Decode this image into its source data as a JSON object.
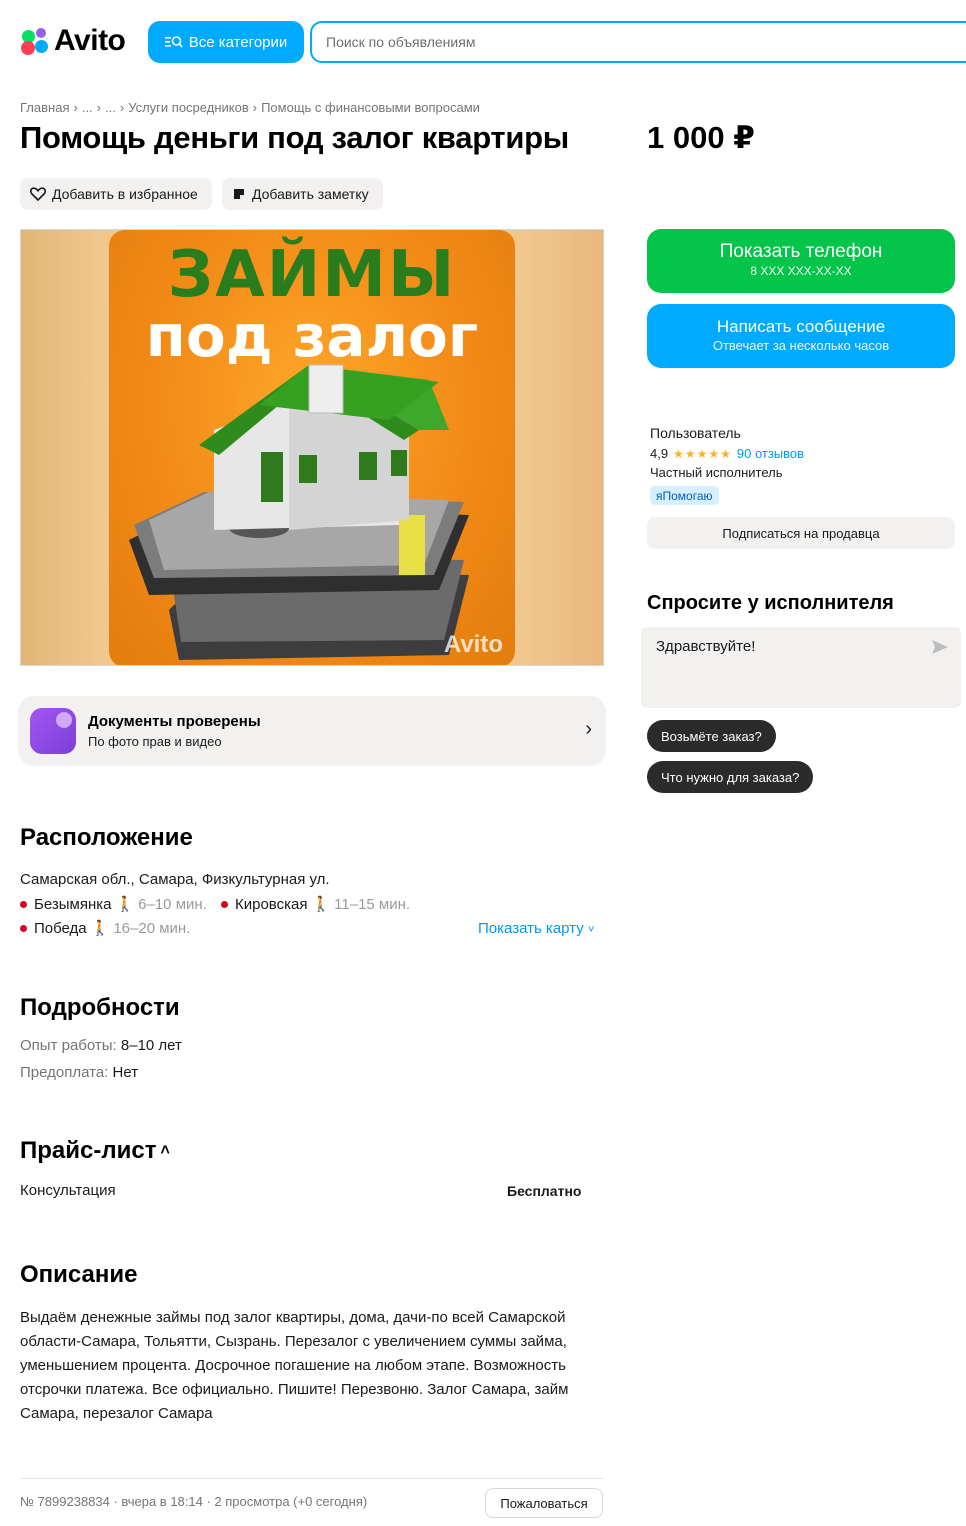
{
  "header": {
    "logo_text": "Avito",
    "categories_button": "Все категории",
    "search_placeholder": "Поиск по объявлениям"
  },
  "breadcrumb": [
    "Главная",
    "›",
    "...",
    "›",
    "...",
    "›",
    "Услуги посредников",
    "›",
    "Помощь с финансовыми вопросами"
  ],
  "listing": {
    "title": "Помощь деньги под залог квартиры",
    "price": "1 000 ₽",
    "favorite_label": "Добавить в избранное",
    "note_label": "Добавить заметку",
    "photo": {
      "line1": "ЗАЙМЫ",
      "line2": "под залог",
      "watermark": "Avito"
    }
  },
  "documents": {
    "title": "Документы проверены",
    "subtitle": "По фото прав и видео"
  },
  "location": {
    "heading": "Расположение",
    "address": "Самарская обл., Самара, Физкультурная ул.",
    "stations": [
      {
        "name": "Безымянка",
        "time": "6–10 мин."
      },
      {
        "name": "Кировская",
        "time": "11–15 мин."
      },
      {
        "name": "Победа",
        "time": "16–20 мин."
      }
    ],
    "show_map": "Показать карту"
  },
  "details": {
    "heading": "Подробности",
    "params": [
      {
        "key": "Опыт работы:",
        "value": "8–10 лет"
      },
      {
        "key": "Предоплата:",
        "value": "Нет"
      }
    ]
  },
  "pricelist": {
    "heading": "Прайс-лист",
    "items": [
      {
        "name": "Консультация",
        "price": "Бесплатно"
      }
    ]
  },
  "description": {
    "heading": "Описание",
    "lines": [
      "Выдаём денежные займы под залог квартиры, дома, дачи-по всей Самарской",
      "области-Самара, Тольятти, Сызрань. Перезалог с увеличением суммы займа,",
      "уменьшением процента. Досрочное погашение на любом этапе. Возможность",
      "отсрочки платежа. Все официально. Пишите! Перезвоню. Залог Самара, займ",
      "Самара, перезалог Самара"
    ]
  },
  "footer": {
    "meta": "№ 7899238834 · вчера в 18:14 · 2 просмотра (+0 сегодня)",
    "complain": "Пожаловаться"
  },
  "contact": {
    "phone_button": "Показать телефон",
    "phone_mask": "8 XXX XXX-XX-XX",
    "message_button": "Написать сообщение",
    "message_sub": "Отвечает за несколько часов"
  },
  "seller": {
    "name": "Пользователь",
    "rating": "4,9",
    "stars": "★★★★★",
    "reviews": "90 отзывов",
    "type": "Частный исполнитель",
    "badge": "яПомогаю",
    "subscribe": "Подписаться на продавца"
  },
  "ask": {
    "heading": "Спросите у исполнителя",
    "message": "Здравствуйте!",
    "quick_replies": [
      "Возьмёте заказ?",
      "Что нужно для заказа?"
    ]
  },
  "colors": {
    "accent_blue": "#00aaff",
    "accent_green": "#04c44a",
    "metro_red": "#d8001e",
    "star": "#ffb021"
  }
}
